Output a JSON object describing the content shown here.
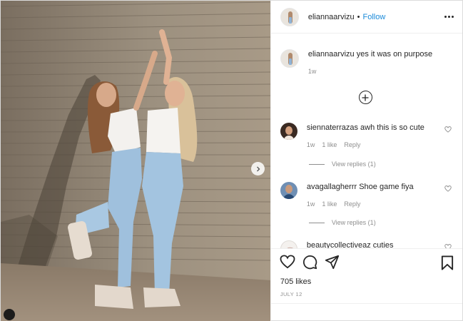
{
  "post": {
    "username": "eliannaarvizu",
    "dot": "•",
    "follow_label": "Follow"
  },
  "caption": {
    "username": "eliannaarvizu",
    "text": "yes it was on purpose",
    "time": "1w"
  },
  "comments": [
    {
      "username": "siennaterrazas",
      "text": "awh this is so cute",
      "time": "1w",
      "likes": "1 like",
      "reply_label": "Reply",
      "view_replies": "View replies (1)"
    },
    {
      "username": "avagallagherrr",
      "text": "Shoe game fiya",
      "time": "1w",
      "likes": "1 like",
      "reply_label": "Reply",
      "view_replies": "View replies (1)"
    },
    {
      "username": "beautycollectiveaz",
      "text": "cuties"
    }
  ],
  "engagement": {
    "likes": "705 likes",
    "date": "JULY 12"
  },
  "icons": {
    "like": "heart-icon",
    "comment": "comment-icon",
    "share": "share-icon",
    "save": "bookmark-icon",
    "load_more": "plus-circle-icon",
    "next": "chevron-right-icon",
    "more": "more-options-icon"
  },
  "colors": {
    "accent": "#1a8ad9",
    "muted": "#8e8e8e",
    "text": "#262626"
  }
}
